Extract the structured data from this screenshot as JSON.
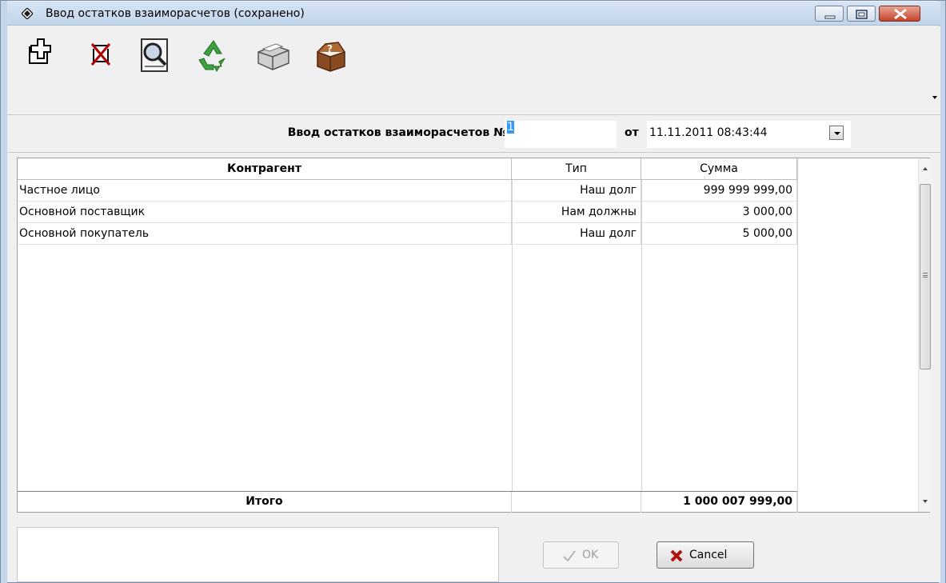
{
  "window": {
    "title": "Ввод остатков взаиморасчетов (сохранено)",
    "controls": {
      "minimize": "minimize-icon",
      "maximize": "maximize-icon",
      "close": "close-icon"
    }
  },
  "toolbar": {
    "buttons": [
      {
        "name": "add-button",
        "icon": "add-document-icon"
      },
      {
        "name": "delete-button",
        "icon": "delete-icon"
      },
      {
        "name": "preview-button",
        "icon": "magnifier-document-icon"
      },
      {
        "name": "refresh-button",
        "icon": "recycle-icon"
      },
      {
        "name": "print-button",
        "icon": "printer-icon"
      },
      {
        "name": "help-button",
        "icon": "help-box-icon"
      }
    ]
  },
  "doc": {
    "label": "Ввод остатков взаиморасчетов №",
    "number": "1",
    "from_label": "от",
    "date": "11.11.2011 08:43:44"
  },
  "grid": {
    "headers": {
      "counterparty": "Контрагент",
      "type": "Тип",
      "sum": "Сумма"
    },
    "rows": [
      {
        "counterparty": "Частное лицо",
        "type": "Наш долг",
        "sum": "999 999 999,00"
      },
      {
        "counterparty": "Основной поставщик",
        "type": "Нам должны",
        "sum": "3 000,00"
      },
      {
        "counterparty": "Основной покупатель",
        "type": "Наш долг",
        "sum": "5 000,00"
      }
    ],
    "total": {
      "label": "Итого",
      "type": "",
      "sum": "1 000 007 999,00"
    }
  },
  "buttons": {
    "ok": "OK",
    "cancel": "Cancel"
  },
  "colors": {
    "selection": "#3399ff",
    "window_bg": "#f0f0f0",
    "close_button": "#c4422a"
  }
}
